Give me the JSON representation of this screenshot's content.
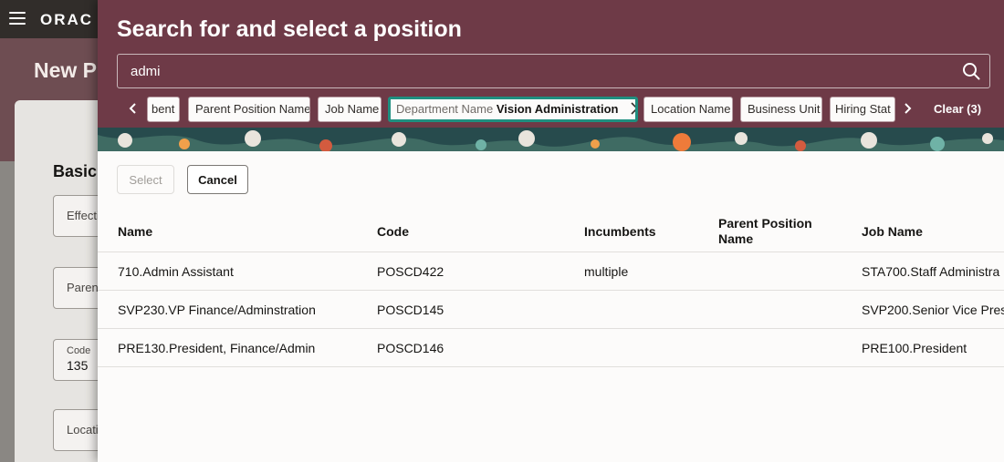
{
  "background": {
    "logo": "ORAC",
    "page_title": "New P",
    "section_title": "Basic",
    "fields": [
      {
        "label": "Effecti"
      },
      {
        "label": "Parent"
      },
      {
        "label": "Code",
        "value": "135"
      },
      {
        "label": "Locati"
      }
    ]
  },
  "drawer": {
    "title": "Search for and select a position",
    "search": {
      "value": "admi"
    },
    "filters": [
      {
        "label": "bent"
      },
      {
        "label": "Parent Position Name"
      },
      {
        "label": "Job Name"
      },
      {
        "label": "Department Name",
        "value": "Vision Administration"
      },
      {
        "label": "Location Name"
      },
      {
        "label": "Business Unit"
      },
      {
        "label": "Hiring Stat"
      }
    ],
    "clear_label": "Clear (3)",
    "buttons": {
      "select": "Select",
      "cancel": "Cancel"
    },
    "table": {
      "columns": [
        "Name",
        "Code",
        "Incumbents",
        "Parent Position Name",
        "Job Name"
      ],
      "rows": [
        [
          "710.Admin Assistant",
          "POSCD422",
          "multiple",
          "",
          "STA700.Staff Administra"
        ],
        [
          "SVP230.VP Finance/Adminstration",
          "POSCD145",
          "",
          "",
          "SVP200.Senior Vice Pres"
        ],
        [
          "PRE130.President, Finance/Admin",
          "POSCD146",
          "",
          "",
          "PRE100.President"
        ]
      ]
    }
  },
  "colors": {
    "header": "#6e3a47",
    "accent_focus": "#1f8f80",
    "topbar": "#312d2a"
  }
}
